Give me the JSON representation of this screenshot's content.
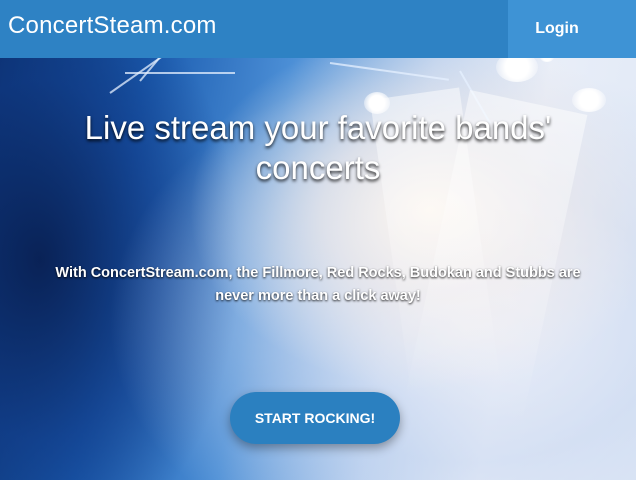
{
  "header": {
    "brand": "ConcertSteam.com",
    "login_label": "Login"
  },
  "hero": {
    "headline": "Live stream your favorite bands' concerts",
    "subtext": "With ConcertStream.com, the Fillmore, Red Rocks, Budokan and Stubbs are never more than a click away!",
    "cta_label": "START ROCKING!",
    "background_image": "concert-stage-blue-spotlights"
  },
  "colors": {
    "header_bg": "#2e82c4",
    "login_bg": "#3e93d5",
    "cta_bg": "#2b80c0",
    "text": "#ffffff"
  }
}
